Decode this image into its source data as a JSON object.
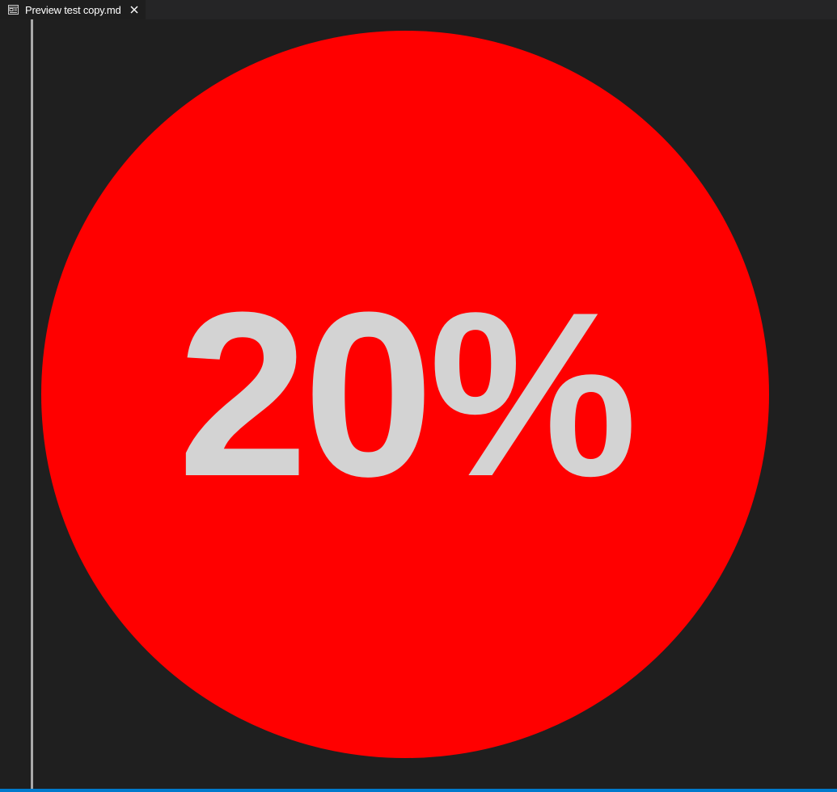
{
  "tab": {
    "icon": "preview-icon",
    "label": "Preview test copy.md",
    "close_icon": "close-icon"
  },
  "preview": {
    "value": "20%",
    "circle_color": "#ff0000",
    "text_color": "#d3d3d3"
  },
  "colors": {
    "background": "#1f1f1f",
    "tabbar": "#252526",
    "statusbar": "#007acc"
  }
}
